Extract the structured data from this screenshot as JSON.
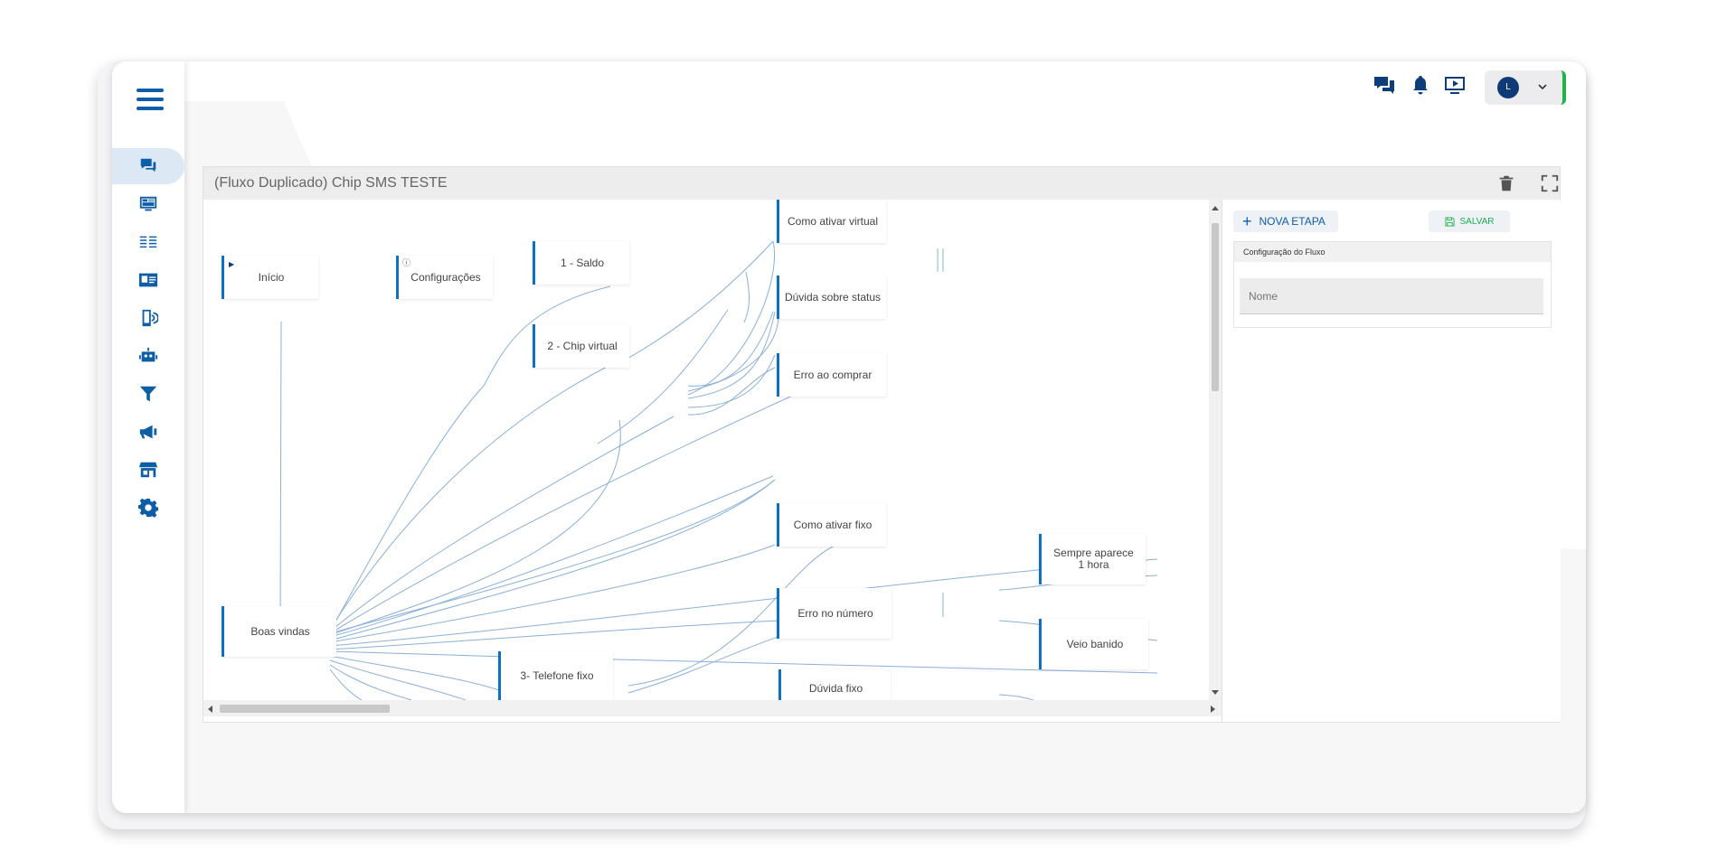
{
  "app": {
    "accent_color": "#0d5ea6",
    "online_color": "#1bb34a"
  },
  "sidebar": {
    "menu_icon": "hamburger-menu-icon",
    "items": [
      {
        "name": "sidebar-item-chat",
        "icon": "chat-bubbles-icon",
        "active": true
      },
      {
        "name": "sidebar-item-monitor",
        "icon": "monitor-dashboard-icon",
        "active": false
      },
      {
        "name": "sidebar-item-list",
        "icon": "list-icon",
        "active": false
      },
      {
        "name": "sidebar-item-contacts",
        "icon": "contact-card-icon",
        "active": false
      },
      {
        "name": "sidebar-item-mobile",
        "icon": "mobile-signal-icon",
        "active": false
      },
      {
        "name": "sidebar-item-bot",
        "icon": "robot-icon",
        "active": false
      },
      {
        "name": "sidebar-item-filter",
        "icon": "funnel-icon",
        "active": false
      },
      {
        "name": "sidebar-item-campaigns",
        "icon": "megaphone-icon",
        "active": false
      },
      {
        "name": "sidebar-item-store",
        "icon": "storefront-icon",
        "active": false
      },
      {
        "name": "sidebar-item-settings",
        "icon": "gear-icon",
        "active": false
      }
    ]
  },
  "topbar": {
    "icons": [
      "chat-bubbles-icon",
      "bell-icon",
      "tv-play-icon"
    ],
    "user_initial": "L"
  },
  "panel": {
    "title": "(Fluxo Duplicado) Chip SMS TESTE",
    "delete_icon": "trash-icon",
    "fullscreen_icon": "fullscreen-icon"
  },
  "flow": {
    "nodes": [
      {
        "id": "inicio",
        "label": "Início"
      },
      {
        "id": "config",
        "label": "Configurações"
      },
      {
        "id": "saldo",
        "label": "1 - Saldo"
      },
      {
        "id": "chip",
        "label": "2 - Chip virtual"
      },
      {
        "id": "ativar_virtual",
        "label": "Como ativar virtual"
      },
      {
        "id": "duvida_status",
        "label": "Dúvida sobre status"
      },
      {
        "id": "erro_comprar",
        "label": "Erro ao comprar"
      },
      {
        "id": "ativar_fixo",
        "label": "Como ativar fixo"
      },
      {
        "id": "sempre",
        "label": "Sempre aparece 1 hora"
      },
      {
        "id": "erro_numero",
        "label": "Erro no número"
      },
      {
        "id": "boas",
        "label": "Boas vindas"
      },
      {
        "id": "veio",
        "label": "Veio banido"
      },
      {
        "id": "telefone",
        "label": "3- Telefone fixo"
      },
      {
        "id": "duvida_fixo",
        "label": "Dúvida fixo"
      }
    ]
  },
  "right_panel": {
    "nova_etapa_label": "NOVA ETAPA",
    "salvar_label": "SALVAR",
    "config_title": "Configuração do Fluxo",
    "nome_placeholder": "Nome"
  }
}
